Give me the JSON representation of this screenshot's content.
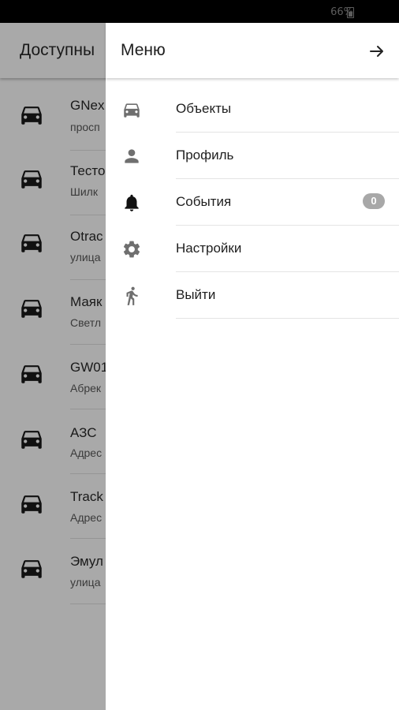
{
  "status_bar": {
    "battery": "66%"
  },
  "background": {
    "title": "Доступны",
    "items": [
      {
        "title": "GNex",
        "subtitle": "просп"
      },
      {
        "title": "Тесто",
        "subtitle": "Шилк"
      },
      {
        "title": "Otrac",
        "subtitle": "улица"
      },
      {
        "title": "Маяк",
        "subtitle": "Светл"
      },
      {
        "title": "GW01",
        "subtitle": "Абрек"
      },
      {
        "title": "АЗС",
        "subtitle": "Адрес"
      },
      {
        "title": "Track",
        "subtitle": "Адрес"
      },
      {
        "title": "Эмул",
        "subtitle": "улица"
      }
    ]
  },
  "drawer": {
    "title": "Меню",
    "close_icon": "arrow-right-icon",
    "items": [
      {
        "label": "Объекты",
        "icon": "car-icon"
      },
      {
        "label": "Профиль",
        "icon": "person-icon"
      },
      {
        "label": "События",
        "icon": "bell-icon",
        "badge": "0"
      },
      {
        "label": "Настройки",
        "icon": "gear-icon"
      },
      {
        "label": "Выйти",
        "icon": "walking-person-icon"
      }
    ]
  },
  "colors": {
    "overlay": "#a9a9a9",
    "drawer_bg": "#ffffff",
    "badge": "#a8a8a8",
    "icon": "#6f6f6f"
  }
}
